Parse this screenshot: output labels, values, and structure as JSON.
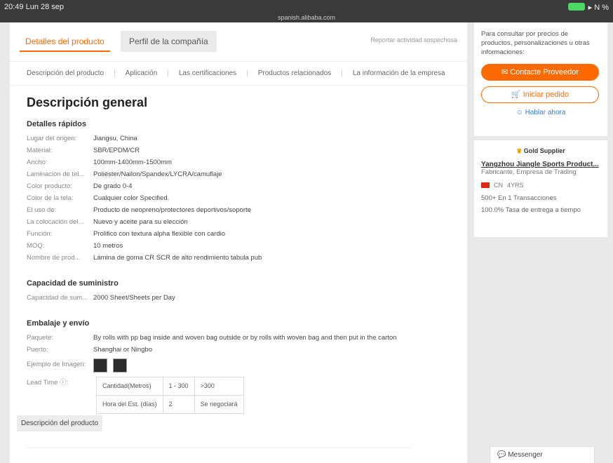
{
  "statusbar": {
    "time": "20:49 Lun 28 sep",
    "url": "spanish.alibaba.com",
    "battery": "▸ N %"
  },
  "tabs": {
    "active": "Detalles del producto",
    "other": "Perfil de la compañía"
  },
  "report": "Reportar actividad sospechosa",
  "subnav": [
    "Descripción del producto",
    "Aplicación",
    "Las certificaciones",
    "Productos relacionados",
    "La información de la empresa"
  ],
  "title": "Descripción general",
  "quick": {
    "heading": "Detalles rápidos",
    "rows": [
      {
        "k": "Lugar del origen:",
        "v": "Jiangsu, China"
      },
      {
        "k": "Material:",
        "v": "SBR/EPDM/CR"
      },
      {
        "k": "Ancho:",
        "v": "100mm-1400mm-1500mm"
      },
      {
        "k": "Laminación de tel...",
        "v": "Poliéster/Nailon/Spandex/LYCRA/camuflaje"
      },
      {
        "k": "Color producto:",
        "v": "De grado 0-4"
      },
      {
        "k": "Color de la tela:",
        "v": "Cualquier color Specified."
      },
      {
        "k": "El uso de:",
        "v": "Producto de neopreno/protectores deportivos/soporte"
      },
      {
        "k": "La colocación del...",
        "v": "Nuevo y aceite para su elección"
      },
      {
        "k": "Función:",
        "v": "Prolifico con textura alpha flexible con cardio"
      },
      {
        "k": "MOQ:",
        "v": "10 metros"
      },
      {
        "k": "Nombre de prod...",
        "v": "Lámina de goma CR SCR de alto rendimiento tabula pub"
      }
    ]
  },
  "supply": {
    "heading": "Capacidad de suministro",
    "rows": [
      {
        "k": "Capacidad de sum...",
        "v": "2000 Sheet/Sheets per Day"
      }
    ]
  },
  "packing": {
    "heading": "Embalaje y envío",
    "rows": [
      {
        "k": "Paquete:",
        "v": "By rolls with pp bag inside and woven bag outside or by rolls with woven bag and then put in the carton"
      },
      {
        "k": "Puerto:",
        "v": "Shanghai or Ningbo"
      }
    ],
    "sample_label": "Ejemplo de Imagen:",
    "lead_label": "Lead Time ⓘ:",
    "lead_table": [
      [
        "Cantidad(Metros)",
        "1 - 300",
        ">300"
      ],
      [
        "Hora del Est. (días)",
        "2",
        "Se negociará"
      ]
    ]
  },
  "desc_button": "Descripción del producto",
  "right": {
    "prompt": "Para consultar por precios de productos, personalizaciones u otras informaciones:",
    "contact": "✉ Contacte Proveedor",
    "start_order": "🛒 Iniciar pedido",
    "chat": "☺ Hablar ahora",
    "gold": "Gold Supplier",
    "company": "Yangzhou Jiangle Sports Product...",
    "company_type": "Fabricante, Empresa de Trading",
    "country": "CN",
    "years": "4YRS",
    "stat1": "500+ En 1 Transacciones",
    "stat2": "100.0% Tasa de entrega a tiempo"
  },
  "messenger": "💬 Messenger"
}
